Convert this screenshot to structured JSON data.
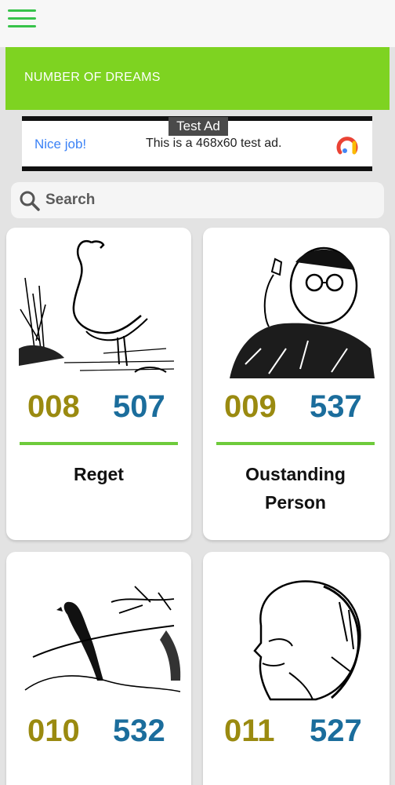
{
  "app": {
    "menu_icon": "hamburger-menu-icon",
    "accent": "#7ed321"
  },
  "banner": {
    "title": "NUMBER OF DREAMS"
  },
  "ad": {
    "tag": "Test Ad",
    "cta": "Nice job!",
    "text": "This is a 468x60 test ad.",
    "logo_icon": "adchoices-logo-icon"
  },
  "search": {
    "placeholder": "Search",
    "icon": "search-icon"
  },
  "cards": [
    {
      "num_a": "008",
      "num_b": "507",
      "title": "Reget",
      "image": "flamingo-illustration"
    },
    {
      "num_a": "009",
      "num_b": "537",
      "title": "Oustanding\nPerson",
      "image": "man-with-glasses-illustration"
    },
    {
      "num_a": "010",
      "num_b": "532",
      "title": "",
      "image": "bird-on-branch-illustration"
    },
    {
      "num_a": "011",
      "num_b": "527",
      "title": "",
      "image": "old-man-profile-illustration"
    }
  ],
  "colors": {
    "num_a": "#9a8a10",
    "num_b": "#1b6d9c",
    "divider": "#6ecb3b"
  }
}
